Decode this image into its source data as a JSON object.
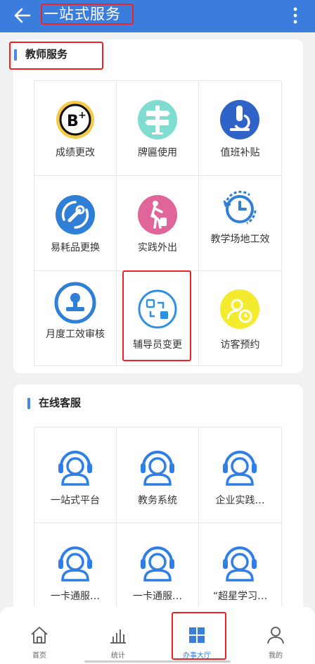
{
  "appbar": {
    "title": "一站式服务",
    "color": "#3b7ddd"
  },
  "teacher": {
    "title": "教师服务",
    "items": [
      {
        "label": "成绩更改",
        "icon": "grade-b-plus-icon"
      },
      {
        "label": "牌匾使用",
        "icon": "signpost-icon"
      },
      {
        "label": "值班补贴",
        "icon": "microscope-icon"
      },
      {
        "label": "易耗品更换",
        "icon": "wrench-refresh-icon"
      },
      {
        "label": "实践外出",
        "icon": "traveler-icon"
      },
      {
        "label": "教学场地工效",
        "icon": "clock-refresh-icon"
      },
      {
        "label": "月度工效审核",
        "icon": "stamp-icon"
      },
      {
        "label": "辅导员变更",
        "icon": "swap-icon"
      },
      {
        "label": "访客预约",
        "icon": "visitor-clock-icon"
      }
    ]
  },
  "online": {
    "title": "在线客服",
    "items": [
      {
        "label": "一站式平台"
      },
      {
        "label": "教务系统"
      },
      {
        "label": "企业实践…"
      },
      {
        "label": "一卡通服…"
      },
      {
        "label": "一卡通服…"
      },
      {
        "label": "“超星学习…"
      }
    ]
  },
  "tabs": [
    {
      "label": "首页",
      "icon": "home-icon"
    },
    {
      "label": "统计",
      "icon": "chart-icon"
    },
    {
      "label": "办事大厅",
      "icon": "grid-icon"
    },
    {
      "label": "我的",
      "icon": "user-icon"
    }
  ]
}
